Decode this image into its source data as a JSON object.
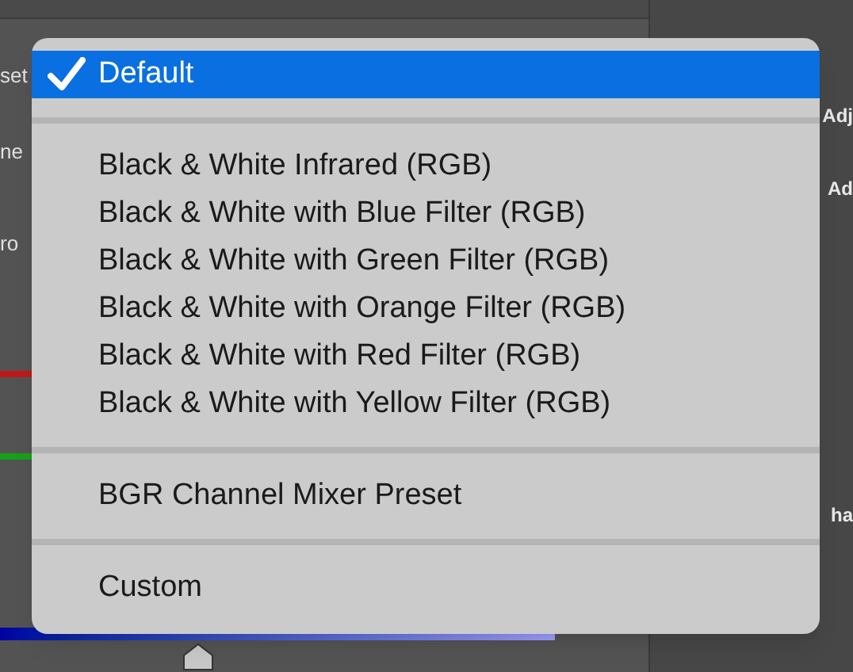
{
  "background": {
    "left_labels": [
      "set",
      "ne",
      "ro"
    ],
    "right_labels": [
      "Adj",
      "Ad",
      "ha"
    ]
  },
  "menu": {
    "items": [
      {
        "kind": "item",
        "label": "Default",
        "selected": true
      },
      {
        "kind": "separator"
      },
      {
        "kind": "item",
        "label": "Black & White Infrared (RGB)",
        "selected": false
      },
      {
        "kind": "item",
        "label": "Black & White with Blue Filter (RGB)",
        "selected": false
      },
      {
        "kind": "item",
        "label": "Black & White with Green Filter (RGB)",
        "selected": false
      },
      {
        "kind": "item",
        "label": "Black & White with Orange Filter (RGB)",
        "selected": false
      },
      {
        "kind": "item",
        "label": "Black & White with Red Filter (RGB)",
        "selected": false
      },
      {
        "kind": "item",
        "label": "Black & White with Yellow Filter (RGB)",
        "selected": false
      },
      {
        "kind": "separator"
      },
      {
        "kind": "item",
        "label": "BGR Channel Mixer Preset",
        "selected": false
      },
      {
        "kind": "separator"
      },
      {
        "kind": "item",
        "label": "Custom",
        "selected": false
      }
    ]
  }
}
